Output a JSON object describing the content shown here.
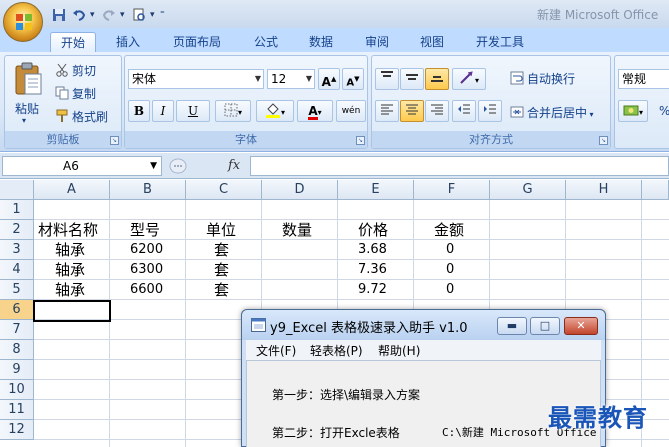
{
  "app": {
    "window_title": "新建 Microsoft Office"
  },
  "qat": {
    "icons": [
      "save-icon",
      "undo-icon",
      "redo-icon",
      "print-preview-icon",
      "customize-icon"
    ]
  },
  "tabs": [
    "开始",
    "插入",
    "页面布局",
    "公式",
    "数据",
    "审阅",
    "视图",
    "开发工具"
  ],
  "active_tab": "开始",
  "ribbon": {
    "clipboard": {
      "label": "剪贴板",
      "paste": "粘贴",
      "cut": "剪切",
      "copy": "复制",
      "format_painter": "格式刷"
    },
    "font": {
      "label": "字体",
      "name": "宋体",
      "size": "12",
      "grow": "A",
      "shrink": "A",
      "bold": "B",
      "italic": "I",
      "underline": "U",
      "font_color": "A",
      "wen": "wén"
    },
    "alignment": {
      "label": "对齐方式",
      "wrap": "自动换行",
      "merge": "合并后居中"
    },
    "number": {
      "format": "常规",
      "percent": "%"
    }
  },
  "formula_bar": {
    "name_box": "A6",
    "fx": "fx",
    "formula": ""
  },
  "sheet": {
    "columns": [
      "A",
      "B",
      "C",
      "D",
      "E",
      "F",
      "G",
      "H"
    ],
    "rows": [
      "1",
      "2",
      "3",
      "4",
      "5",
      "6",
      "7",
      "8",
      "9",
      "10",
      "11",
      "12"
    ],
    "selected_row": "6",
    "headers": {
      "a": "材料名称",
      "b": "型号",
      "c": "单位",
      "d": "数量",
      "e": "价格",
      "f": "金额"
    },
    "data": [
      {
        "a": "轴承",
        "b": "6200",
        "c": "套",
        "e": "3.68",
        "f": "0"
      },
      {
        "a": "轴承",
        "b": "6300",
        "c": "套",
        "e": "7.36",
        "f": "0"
      },
      {
        "a": "轴承",
        "b": "6600",
        "c": "套",
        "e": "9.72",
        "f": "0"
      }
    ]
  },
  "dialog": {
    "title": "y9_Excel 表格极速录入助手 v1.0",
    "menu": [
      "文件(F)",
      "轻表格(P)",
      "帮助(H)"
    ],
    "step1": "第一步：选择\\编辑录入方案",
    "step2": "第二步：打开Excle表格",
    "path": "C:\\新建 Microsoft Office"
  },
  "watermark": "最需教育",
  "colors": {
    "accent": "#15428b",
    "selection": "#f7d38c",
    "ribbon": "#dbe8f8"
  }
}
